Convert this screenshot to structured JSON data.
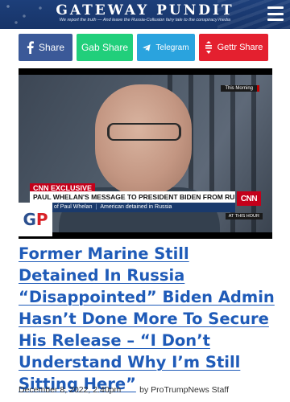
{
  "header": {
    "site_title": "GATEWAY PUNDIT",
    "tagline": "We report the truth — And leave the Russia-Collusion fairy tale to the conspiracy media",
    "menu_icon": "hamburger-menu-icon"
  },
  "share_buttons": [
    {
      "label": "Share",
      "icon": "facebook-icon",
      "color": "#3b5998"
    },
    {
      "label": "Gab Share",
      "icon": "",
      "color": "#21cf7b"
    },
    {
      "label": "Telegram",
      "icon": "telegram-icon",
      "color": "#2aa3de"
    },
    {
      "label": "Gettr Share",
      "icon": "gettr-icon",
      "color": "#e4202f"
    }
  ],
  "media": {
    "live_tag": "This Morning",
    "exclusive_label": "CNN EXCLUSIVE",
    "headline": "PAUL WHELAN'S MESSAGE TO PRESIDENT BIDEN FROM RUSSIAN PRISON",
    "network_logo": "CNN",
    "subtitle_name": "of Paul Whelan",
    "subtitle_desc": "American detained in Russia",
    "time_tag": "AT THIS HOUR",
    "watermark": "GP"
  },
  "article": {
    "title": "Former Marine Still Detained In Russia “Disappointed” Biden Admin Hasn’t Done More To Secure His Release – “I Don’t Understand Why I’m Still Sitting Here”",
    "date": "December 8, 2022, 2:40pm",
    "byline": "by ProTrumpNews Staff"
  },
  "colors": {
    "header_bg": "#1d3f7a",
    "title_link": "#1f5bb8",
    "cnn_red": "#c4001a"
  }
}
